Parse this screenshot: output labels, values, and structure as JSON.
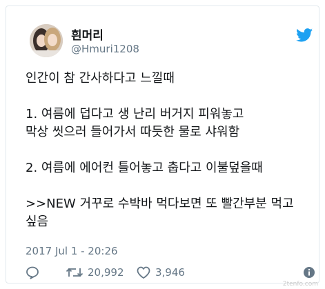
{
  "tweet": {
    "author": {
      "display_name": "흰머리",
      "handle": "@Hmuri1208"
    },
    "text_lines": [
      "인간이 참 간사하다고 느낄때",
      "",
      "1. 여름에 덥다고 생 난리 버거지 피워놓고",
      "막상 씻으러 들어가서 따듯한 물로 샤워함",
      "",
      "2. 여름에 에어컨 틀어놓고 춥다고 이불덮을때",
      "",
      ">>NEW 거꾸로 수박바 먹다보면 또 빨간부분 먹고",
      "싶음"
    ],
    "timestamp": "2017 Jul 1 - 20:26",
    "stats": {
      "retweets": "20,992",
      "likes": "3,946"
    }
  },
  "watermark": "2tenfo.com",
  "colors": {
    "brand": "#1da1f2",
    "text": "#14171a",
    "secondary": "#657786"
  },
  "icons": [
    "twitter-bird-icon",
    "reply-icon",
    "retweet-icon",
    "heart-icon",
    "info-icon"
  ]
}
